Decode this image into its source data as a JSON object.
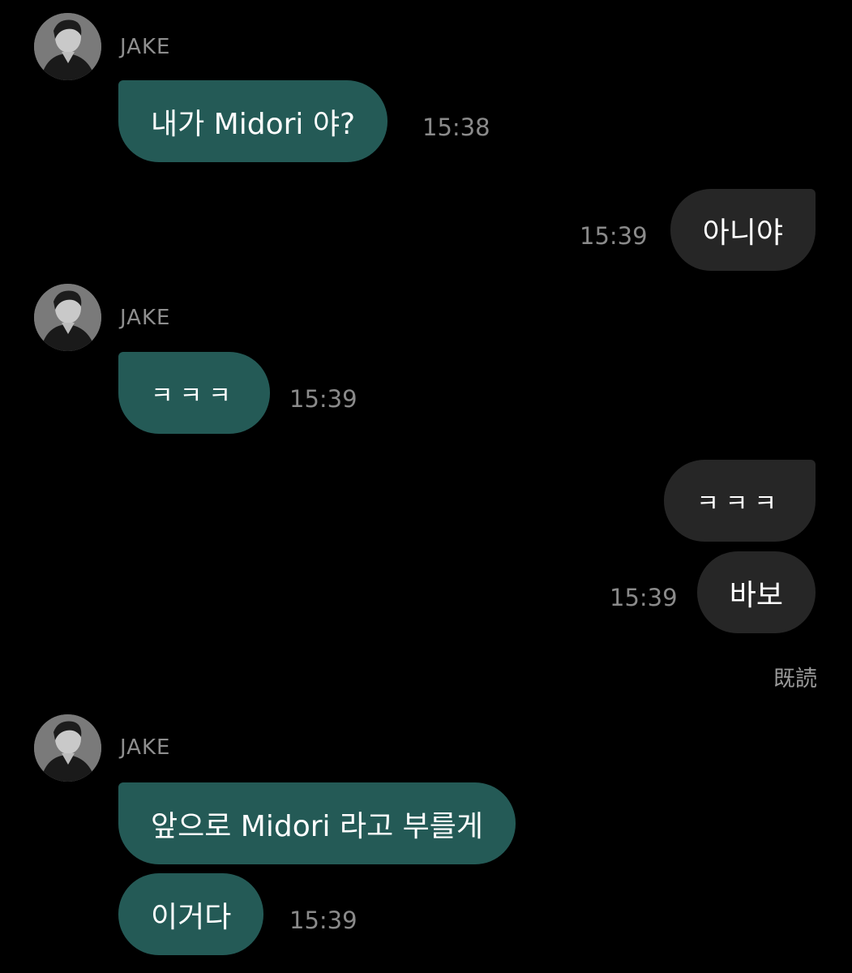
{
  "colors": {
    "background": "#000000",
    "incoming_bubble": "#245a56",
    "outgoing_bubble": "#262626",
    "timestamp": "#8a8a8a",
    "sender_name": "#8e8e8e"
  },
  "messages": [
    {
      "direction": "incoming",
      "sender": "JAKE",
      "text": "내가 Midori 야?",
      "time": "15:38",
      "avatar": "profile-photo"
    },
    {
      "direction": "outgoing",
      "text": "아니야",
      "time": "15:39"
    },
    {
      "direction": "incoming",
      "sender": "JAKE",
      "text": "ㅋㅋㅋ",
      "time": "15:39",
      "avatar": "profile-photo"
    },
    {
      "direction": "outgoing",
      "text": "ㅋㅋㅋ"
    },
    {
      "direction": "outgoing",
      "text": "바보",
      "time": "15:39"
    },
    {
      "direction": "status",
      "text": "既読"
    },
    {
      "direction": "incoming",
      "sender": "JAKE",
      "text": "앞으로 Midori 라고 부를게",
      "avatar": "profile-photo"
    },
    {
      "direction": "incoming",
      "text": "이거다",
      "time": "15:39"
    }
  ]
}
